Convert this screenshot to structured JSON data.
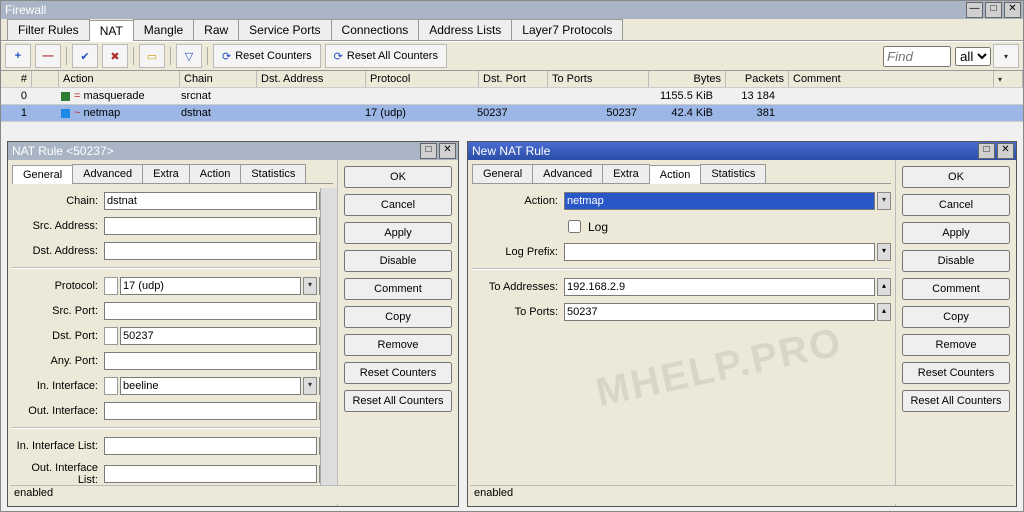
{
  "main": {
    "title": "Firewall",
    "tabs": [
      "Filter Rules",
      "NAT",
      "Mangle",
      "Raw",
      "Service Ports",
      "Connections",
      "Address Lists",
      "Layer7 Protocols"
    ],
    "active_tab": 1,
    "toolbar": {
      "reset_counters": "Reset Counters",
      "reset_all_counters": "Reset All Counters",
      "find_placeholder": "Find",
      "filter_value": "all"
    },
    "columns": [
      "#",
      "",
      "Action",
      "Chain",
      "Dst. Address",
      "Protocol",
      "Dst. Port",
      "To Ports",
      "Bytes",
      "Packets",
      "Comment"
    ],
    "rows": [
      {
        "n": "0",
        "action": "masquerade",
        "chain": "srcnat",
        "dst": "",
        "proto": "",
        "dport": "",
        "tports": "",
        "bytes": "1155.5 KiB",
        "pkts": "13 184",
        "flag_color": "#2e7d32",
        "icon": "="
      },
      {
        "n": "1",
        "action": "netmap",
        "chain": "dstnat",
        "dst": "",
        "proto": "17 (udp)",
        "dport": "50237",
        "tports": "50237",
        "bytes": "42.4 KiB",
        "pkts": "381",
        "flag_color": "#1e88e5",
        "icon": "~"
      }
    ]
  },
  "left": {
    "title": "NAT Rule <50237>",
    "tabs": [
      "General",
      "Advanced",
      "Extra",
      "Action",
      "Statistics"
    ],
    "active_tab": 0,
    "fields": {
      "chain_label": "Chain:",
      "chain": "dstnat",
      "src_addr_label": "Src. Address:",
      "src_addr": "",
      "dst_addr_label": "Dst. Address:",
      "dst_addr": "",
      "proto_label": "Protocol:",
      "proto": "17 (udp)",
      "src_port_label": "Src. Port:",
      "src_port": "",
      "dst_port_label": "Dst. Port:",
      "dst_port": "50237",
      "any_port_label": "Any. Port:",
      "any_port": "",
      "in_if_label": "In. Interface:",
      "in_if": "beeline",
      "out_if_label": "Out. Interface:",
      "out_if": "",
      "in_if_list_label": "In. Interface List:",
      "in_if_list": "",
      "out_if_list_label": "Out. Interface List:",
      "out_if_list": ""
    },
    "status": "enabled",
    "buttons": [
      "OK",
      "Cancel",
      "Apply",
      "Disable",
      "Comment",
      "Copy",
      "Remove",
      "Reset Counters",
      "Reset All Counters"
    ]
  },
  "right": {
    "title": "New NAT Rule",
    "tabs": [
      "General",
      "Advanced",
      "Extra",
      "Action",
      "Statistics"
    ],
    "active_tab": 3,
    "fields": {
      "action_label": "Action:",
      "action": "netmap",
      "log_label": "Log",
      "log_prefix_label": "Log Prefix:",
      "log_prefix": "",
      "to_addr_label": "To Addresses:",
      "to_addr": "192.168.2.9",
      "to_ports_label": "To Ports:",
      "to_ports": "50237"
    },
    "status": "enabled",
    "buttons": [
      "OK",
      "Cancel",
      "Apply",
      "Disable",
      "Comment",
      "Copy",
      "Remove",
      "Reset Counters",
      "Reset All Counters"
    ]
  },
  "watermark": "MHELP.PRO"
}
